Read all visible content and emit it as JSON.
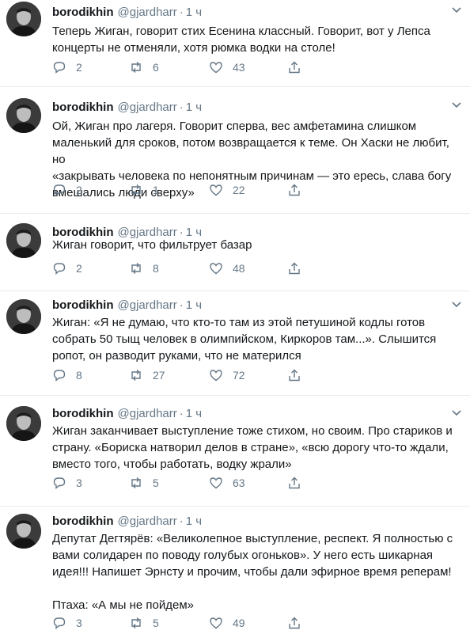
{
  "tweets": [
    {
      "name": "borodikhin",
      "handle": "@gjardharr",
      "dot": "·",
      "time": "1 ч",
      "text": "Теперь Жиган, говорит стих Есенина классный. Говорит, вот у Лепса\nконцерты не отменяли, хотя рюмка водки на столе!",
      "replies": "2",
      "retweets": "6",
      "likes": "43"
    },
    {
      "name": "borodikhin",
      "handle": "@gjardharr",
      "dot": "·",
      "time": "1 ч",
      "text": "Ой, Жиган про лагеря. Говорит сперва, вес амфетамина слишком\nмаленький для сроков, потом возвращается к теме. Он Хаски не любит, но\n«закрывать человека по непонятным причинам — это ересь, слава богу\nвмешались люди сверху»",
      "replies": "2",
      "retweets": "1",
      "likes": "22"
    },
    {
      "name": "borodikhin",
      "handle": "@gjardharr",
      "dot": "·",
      "time": "1 ч",
      "text": "Жиган говорит, что фильтрует базар",
      "replies": "2",
      "retweets": "8",
      "likes": "48"
    },
    {
      "name": "borodikhin",
      "handle": "@gjardharr",
      "dot": "·",
      "time": "1 ч",
      "text": "Жиган: «Я не думаю, что кто-то там из этой петушиной кодлы готов\nсобрать 50 тыщ человек в олимпийском, Киркоров там...». Слышится\nропот, он разводит руками, что не матерился",
      "replies": "8",
      "retweets": "27",
      "likes": "72"
    },
    {
      "name": "borodikhin",
      "handle": "@gjardharr",
      "dot": "·",
      "time": "1 ч",
      "text": "Жиган заканчивает выступление тоже стихом, но своим. Про стариков и\nстрану. «Бориска натворил делов в стране», «всю дорогу что-то ждали,\nвместо того, чтобы работать, водку жрали»",
      "replies": "3",
      "retweets": "5",
      "likes": "63"
    },
    {
      "name": "borodikhin",
      "handle": "@gjardharr",
      "dot": "·",
      "time": "1 ч",
      "text": "Депутат Дегтярёв: «Великолепное выступление, респект. Я полностью с\nвами солидарен по поводу голубых огоньков». У него есть шикарная\nидея!!! Напишет Эрнсту и прочим, чтобы дали эфирное время реперам!\n\nПтаха: «А мы не пойдем»",
      "replies": "3",
      "retweets": "5",
      "likes": "49"
    }
  ],
  "icons": {
    "reply": "reply-icon",
    "retweet": "retweet-icon",
    "like": "like-icon",
    "share": "share-icon",
    "more": "chevron-down-icon"
  },
  "colors": {
    "text": "#14171a",
    "muted": "#657786",
    "divider": "#e6ecf0"
  }
}
